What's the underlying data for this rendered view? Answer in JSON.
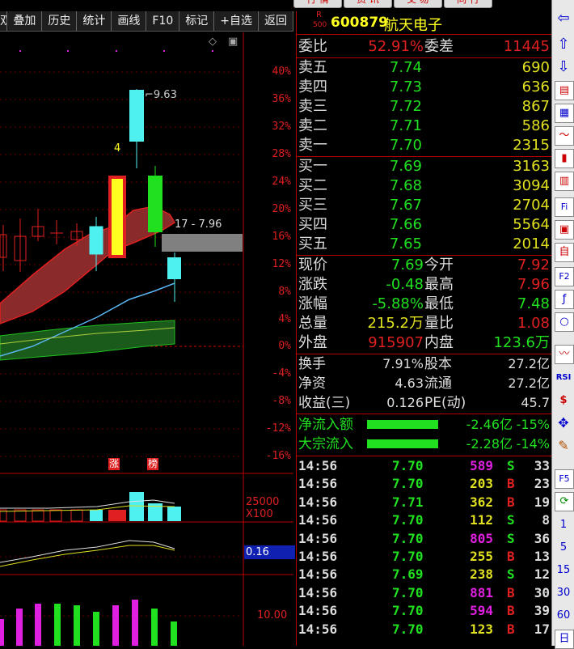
{
  "toolbar": {
    "items": [
      "双",
      "叠加",
      "历史",
      "统计",
      "画线",
      "F10",
      "标记",
      "+自选",
      "返回"
    ]
  },
  "top_tabs": [
    "行 情",
    "资 讯",
    "交 易",
    "同 行"
  ],
  "axis_pct": [
    "40%",
    "36%",
    "32%",
    "28%",
    "24%",
    "20%",
    "16%",
    "12%",
    "8%",
    "4%",
    "0%",
    "-4%",
    "-8%",
    "-12%",
    "-16%"
  ],
  "chart_annotations": {
    "high_label": "9.63",
    "price_line": "17 - 7.96",
    "candle_num": "4",
    "tag_zhang": "涨",
    "tag_bang": "榜",
    "vol_axis": "25000",
    "vol_unit": "X100",
    "ind_value": "0.16",
    "macd_axis": "10.00"
  },
  "stock": {
    "market_tag_top": "R",
    "market_tag_bottom": "500",
    "code": "600879",
    "name": "航天电子"
  },
  "weibi": {
    "label1": "委比",
    "value1": "52.91%",
    "label2": "委差",
    "value2": "11445"
  },
  "sells": [
    {
      "label": "卖五",
      "price": "7.74",
      "vol": "690"
    },
    {
      "label": "卖四",
      "price": "7.73",
      "vol": "636"
    },
    {
      "label": "卖三",
      "price": "7.72",
      "vol": "867"
    },
    {
      "label": "卖二",
      "price": "7.71",
      "vol": "586"
    },
    {
      "label": "卖一",
      "price": "7.70",
      "vol": "2315"
    }
  ],
  "buys": [
    {
      "label": "买一",
      "price": "7.69",
      "vol": "3163"
    },
    {
      "label": "买二",
      "price": "7.68",
      "vol": "3094"
    },
    {
      "label": "买三",
      "price": "7.67",
      "vol": "2704"
    },
    {
      "label": "买四",
      "price": "7.66",
      "vol": "5564"
    },
    {
      "label": "买五",
      "price": "7.65",
      "vol": "2014"
    }
  ],
  "stats": [
    {
      "l1": "现价",
      "v1": "7.69",
      "c1": "#20e020",
      "l2": "今开",
      "v2": "7.92",
      "c2": "#e02020"
    },
    {
      "l1": "涨跌",
      "v1": "-0.48",
      "c1": "#20e020",
      "l2": "最高",
      "v2": "7.96",
      "c2": "#e02020"
    },
    {
      "l1": "涨幅",
      "v1": "-5.88%",
      "c1": "#20e020",
      "l2": "最低",
      "v2": "7.48",
      "c2": "#20e020"
    },
    {
      "l1": "总量",
      "v1": "215.2万",
      "c1": "#e0e020",
      "l2": "量比",
      "v2": "1.08",
      "c2": "#e02020"
    },
    {
      "l1": "外盘",
      "v1": "915907",
      "c1": "#e02020",
      "l2": "内盘",
      "v2": "123.6万",
      "c2": "#20e020"
    }
  ],
  "fin": [
    {
      "l1": "换手",
      "v1": "7.91%",
      "l2": "股本",
      "v2": "27.2亿"
    },
    {
      "l1": "净资",
      "v1": "4.63",
      "l2": "流通",
      "v2": "27.2亿"
    },
    {
      "l1": "收益(三)",
      "v1": "0.126",
      "l2": "PE(动)",
      "v2": "45.7"
    }
  ],
  "flows": [
    {
      "label": "净流入额",
      "value": "-2.46亿",
      "pct": "-15%"
    },
    {
      "label": "大宗流入",
      "value": "-2.28亿",
      "pct": "-14%"
    }
  ],
  "ticks": [
    {
      "time": "14:56",
      "price": "7.70",
      "pc": "#20e020",
      "vol": "589",
      "vc": "#e020e0",
      "side": "S",
      "sc": "#20e020",
      "n": "33"
    },
    {
      "time": "14:56",
      "price": "7.70",
      "pc": "#20e020",
      "vol": "203",
      "vc": "#e0e020",
      "side": "B",
      "sc": "#e02020",
      "n": "23"
    },
    {
      "time": "14:56",
      "price": "7.71",
      "pc": "#20e020",
      "vol": "362",
      "vc": "#e0e020",
      "side": "B",
      "sc": "#e02020",
      "n": "19"
    },
    {
      "time": "14:56",
      "price": "7.70",
      "pc": "#20e020",
      "vol": "112",
      "vc": "#e0e020",
      "side": "S",
      "sc": "#20e020",
      "n": "8"
    },
    {
      "time": "14:56",
      "price": "7.70",
      "pc": "#20e020",
      "vol": "805",
      "vc": "#e020e0",
      "side": "S",
      "sc": "#20e020",
      "n": "36"
    },
    {
      "time": "14:56",
      "price": "7.70",
      "pc": "#20e020",
      "vol": "255",
      "vc": "#e0e020",
      "side": "B",
      "sc": "#e02020",
      "n": "13"
    },
    {
      "time": "14:56",
      "price": "7.69",
      "pc": "#20e020",
      "vol": "238",
      "vc": "#e0e020",
      "side": "S",
      "sc": "#20e020",
      "n": "12"
    },
    {
      "time": "14:56",
      "price": "7.70",
      "pc": "#20e020",
      "vol": "881",
      "vc": "#e020e0",
      "side": "B",
      "sc": "#e02020",
      "n": "30"
    },
    {
      "time": "14:56",
      "price": "7.70",
      "pc": "#20e020",
      "vol": "594",
      "vc": "#e020e0",
      "side": "B",
      "sc": "#e02020",
      "n": "39"
    },
    {
      "time": "14:56",
      "price": "7.70",
      "pc": "#20e020",
      "vol": "123",
      "vc": "#e0e020",
      "side": "B",
      "sc": "#e02020",
      "n": "17"
    }
  ],
  "iconbar_text": {
    "f5": "F5",
    "n1": "1",
    "n5": "5",
    "n15": "15",
    "n30": "30",
    "n60": "60",
    "day": "日",
    "f10": "F10",
    "fi": "Fi",
    "fz": "F2",
    "rsi": "RSI"
  }
}
